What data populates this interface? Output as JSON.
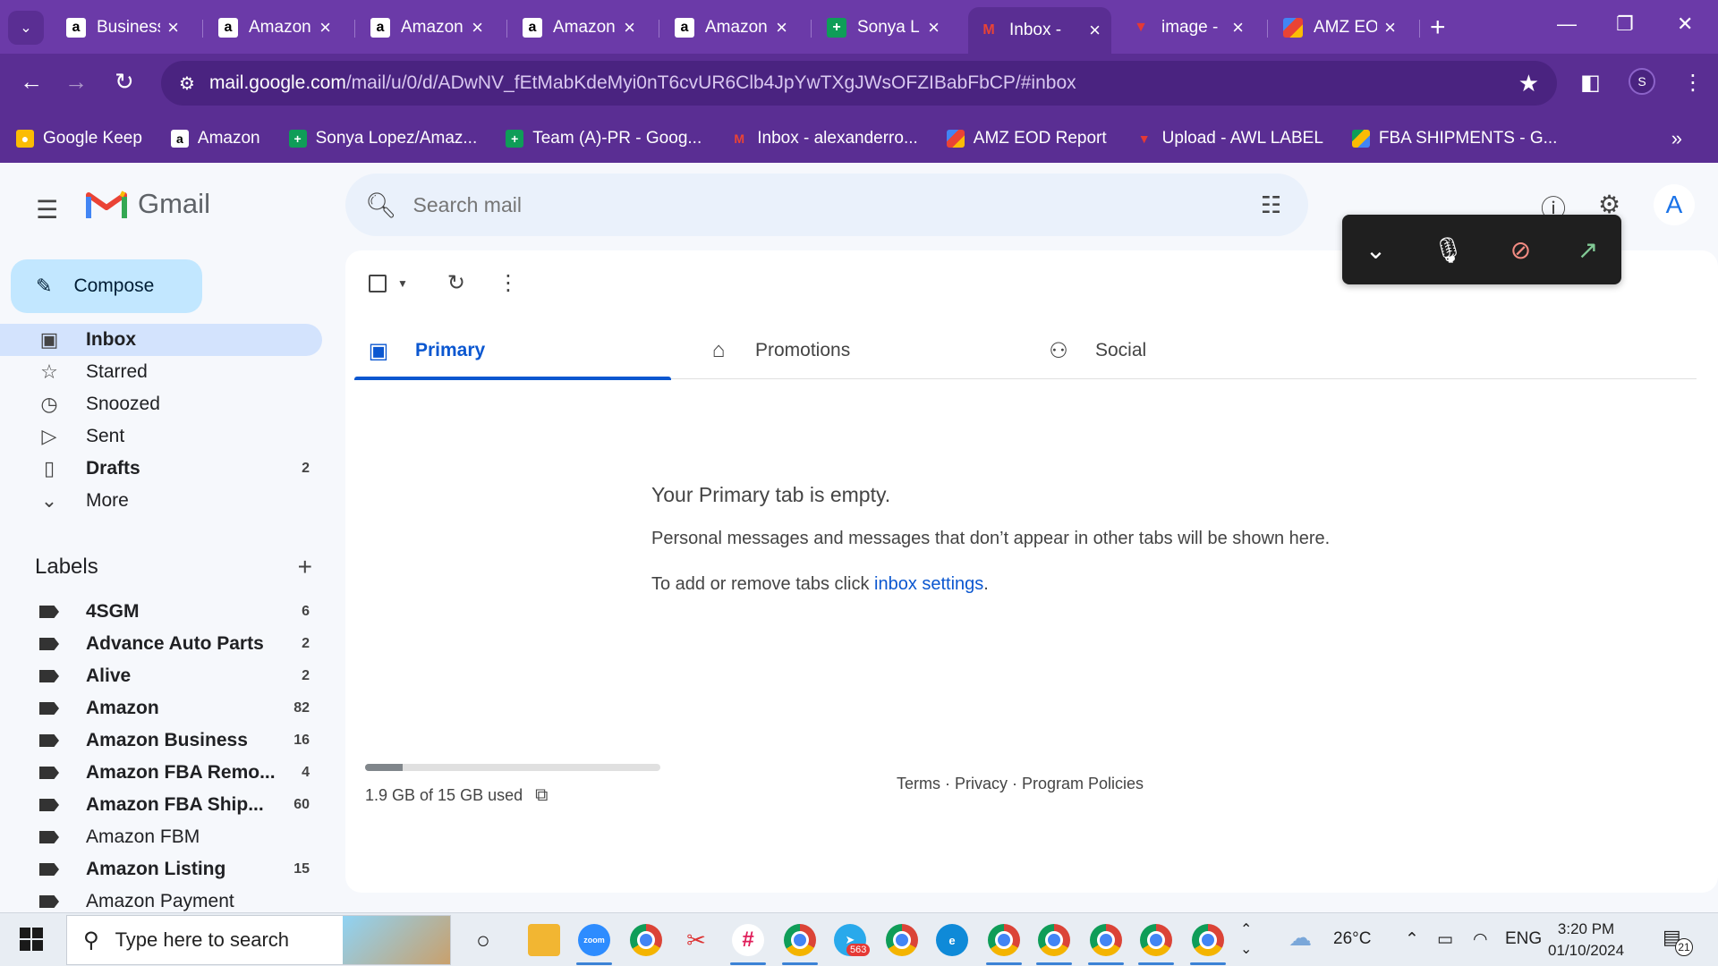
{
  "browser": {
    "tabs": [
      {
        "label": "Business",
        "favicon": "amazon-a"
      },
      {
        "label": "Amazon",
        "favicon": "amazon-a"
      },
      {
        "label": "Amazon",
        "favicon": "amazon-a"
      },
      {
        "label": "Amazon",
        "favicon": "amazon-a"
      },
      {
        "label": "Amazon",
        "favicon": "amazon-a"
      },
      {
        "label": "Sonya L",
        "favicon": "sheets-plus"
      },
      {
        "label": "Inbox -",
        "favicon": "gmail-m"
      },
      {
        "label": "image -",
        "favicon": "awl-red"
      },
      {
        "label": "AMZ EO",
        "favicon": "multi-color"
      }
    ],
    "active_tab_index": 6,
    "url_host": "mail.google.com",
    "url_path": "/mail/u/0/d/ADwNV_fEtMabKdeMyi0nT6cvUR6Clb4JpYwTXgJWsOFZIBabFbCP/#inbox",
    "profile_initial": "S",
    "bookmarks": [
      {
        "label": "Google Keep",
        "favicon": "keep-bulb"
      },
      {
        "label": "Amazon",
        "favicon": "amazon-a"
      },
      {
        "label": "Sonya Lopez/Amaz...",
        "favicon": "sheets-plus"
      },
      {
        "label": "Team (A)-PR - Goog...",
        "favicon": "sheets-plus"
      },
      {
        "label": "Inbox - alexanderro...",
        "favicon": "gmail-m"
      },
      {
        "label": "AMZ EOD Report",
        "favicon": "multi-color"
      },
      {
        "label": "Upload - AWL LABEL",
        "favicon": "awl-red"
      },
      {
        "label": "FBA SHIPMENTS - G...",
        "favicon": "drive-triangle"
      }
    ]
  },
  "gmail": {
    "logo_text": "Gmail",
    "search_placeholder": "Search mail",
    "compose_label": "Compose",
    "avatar_initial": "A",
    "nav": [
      {
        "label": "Inbox",
        "icon": "inbox-icon",
        "count": "",
        "active": true
      },
      {
        "label": "Starred",
        "icon": "star-icon",
        "count": ""
      },
      {
        "label": "Snoozed",
        "icon": "clock-icon",
        "count": ""
      },
      {
        "label": "Sent",
        "icon": "send-icon",
        "count": ""
      },
      {
        "label": "Drafts",
        "icon": "draft-icon",
        "count": "2",
        "bold": true
      },
      {
        "label": "More",
        "icon": "chevron-down-icon",
        "count": ""
      }
    ],
    "labels_title": "Labels",
    "labels": [
      {
        "label": "4SGM",
        "count": "6",
        "bold": true
      },
      {
        "label": "Advance Auto Parts",
        "count": "2",
        "bold": true
      },
      {
        "label": "Alive",
        "count": "2",
        "bold": true
      },
      {
        "label": "Amazon",
        "count": "82",
        "bold": true
      },
      {
        "label": "Amazon Business",
        "count": "16",
        "bold": true
      },
      {
        "label": "Amazon FBA Remo...",
        "count": "4",
        "bold": true
      },
      {
        "label": "Amazon FBA Ship...",
        "count": "60",
        "bold": true
      },
      {
        "label": "Amazon FBM",
        "count": "",
        "bold": false
      },
      {
        "label": "Amazon Listing",
        "count": "15",
        "bold": true
      },
      {
        "label": "Amazon Payment",
        "count": "",
        "bold": false
      }
    ],
    "category_tabs": [
      {
        "label": "Primary",
        "icon": "inbox-tab-icon",
        "active": true
      },
      {
        "label": "Promotions",
        "icon": "tag-icon"
      },
      {
        "label": "Social",
        "icon": "people-icon"
      }
    ],
    "empty_state": {
      "title": "Your Primary tab is empty.",
      "line1": "Personal messages and messages that don’t appear in other tabs will be shown here.",
      "line2_prefix": "To add or remove tabs click ",
      "line2_link": "inbox settings",
      "line2_suffix": "."
    },
    "storage": {
      "text": "1.9 GB of 15 GB used",
      "used_fraction": 0.127
    },
    "footer": {
      "terms": "Terms",
      "privacy": "Privacy",
      "policies": "Program Policies",
      "sep": " · "
    }
  },
  "taskbar": {
    "search_placeholder": "Type here to search",
    "zoom_label": "zoom",
    "telegram_badge": "563",
    "weather": "26°C",
    "language": "ENG",
    "time": "3:20 PM",
    "date": "01/10/2024",
    "notification_count": "21"
  }
}
